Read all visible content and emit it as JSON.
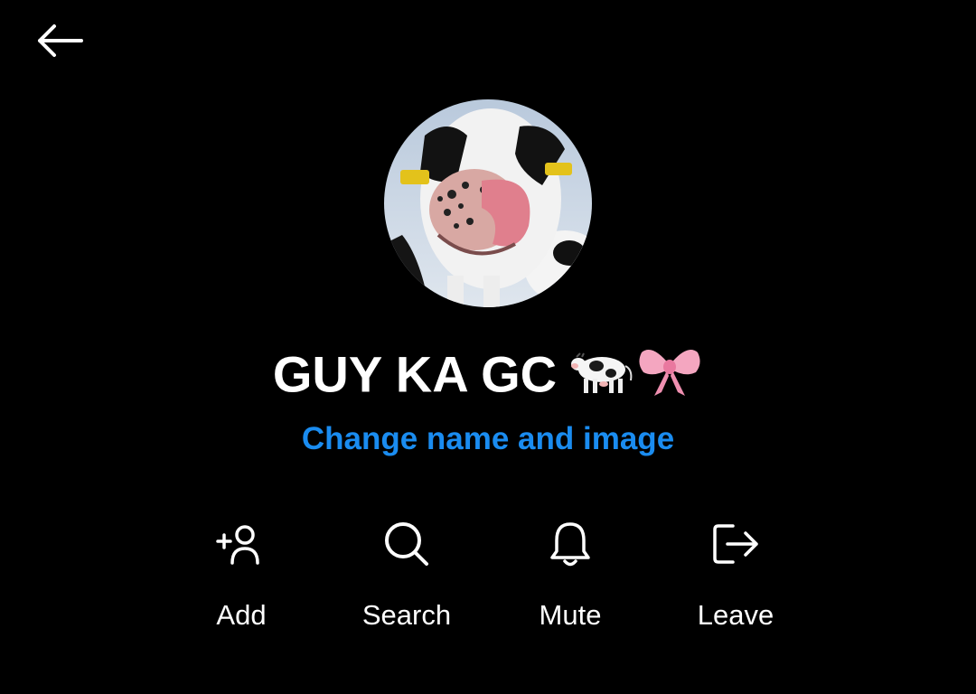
{
  "header": {
    "back_icon": "arrow-left-icon"
  },
  "group": {
    "avatar_icon": "cow-photo-avatar",
    "name": "GUY KA GC",
    "name_emojis": [
      "cow-emoji",
      "pink-bow-emoji"
    ],
    "change_link": "Change name and image"
  },
  "actions": [
    {
      "label": "Add",
      "icon": "add-person-icon"
    },
    {
      "label": "Search",
      "icon": "search-icon"
    },
    {
      "label": "Mute",
      "icon": "bell-icon"
    },
    {
      "label": "Leave",
      "icon": "leave-door-icon"
    }
  ],
  "colors": {
    "background": "#000000",
    "text": "#ffffff",
    "link": "#1a8cf0"
  }
}
